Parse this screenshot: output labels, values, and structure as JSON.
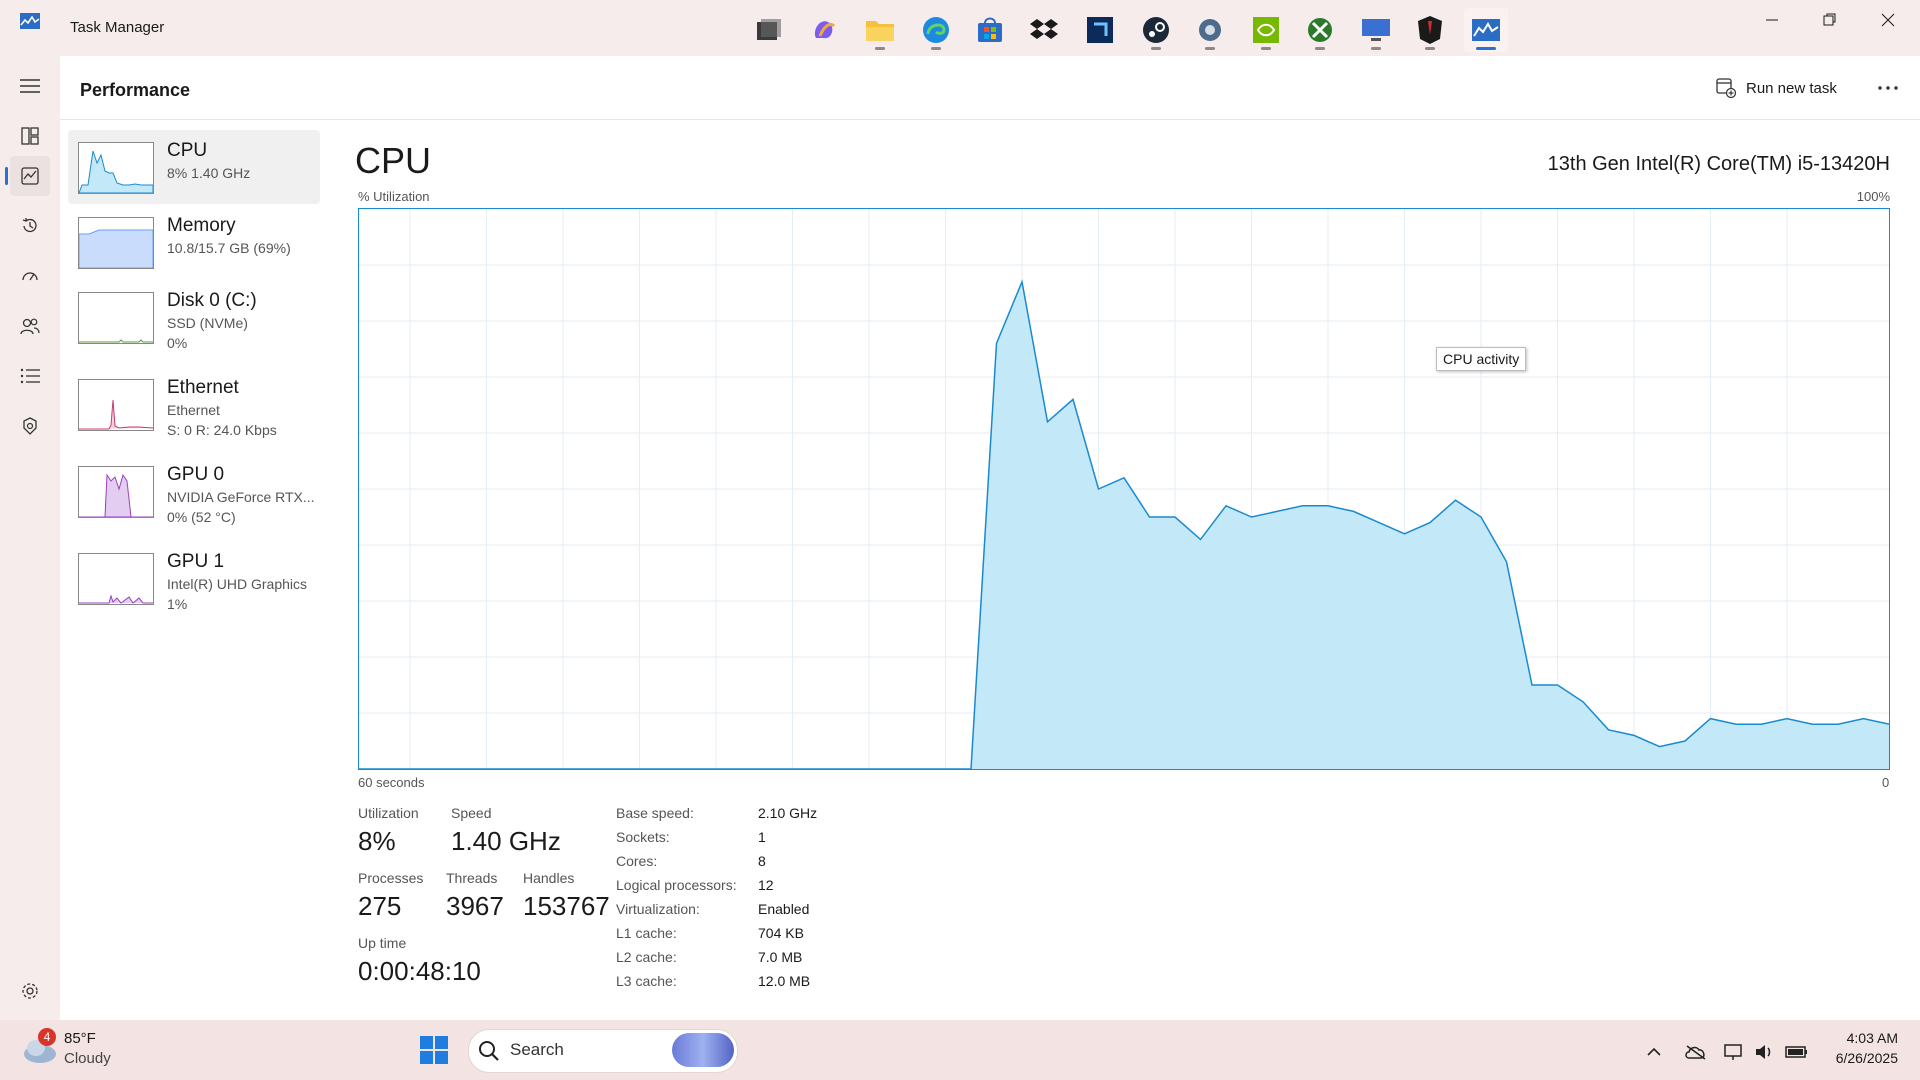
{
  "window": {
    "title": "Task Manager",
    "page_title": "Performance",
    "run_new_task": "Run new task"
  },
  "sidebar": [
    {
      "name": "CPU",
      "line2": "8%  1.40 GHz",
      "line3": ""
    },
    {
      "name": "Memory",
      "line2": "10.8/15.7 GB (69%)",
      "line3": ""
    },
    {
      "name": "Disk 0 (C:)",
      "line2": "SSD (NVMe)",
      "line3": "0%"
    },
    {
      "name": "Ethernet",
      "line2": "Ethernet",
      "line3": "S: 0 R: 24.0 Kbps"
    },
    {
      "name": "GPU 0",
      "line2": "NVIDIA GeForce RTX...",
      "line3": "0% (52 °C)"
    },
    {
      "name": "GPU 1",
      "line2": "Intel(R) UHD Graphics",
      "line3": "1%"
    }
  ],
  "cpu": {
    "title": "CPU",
    "model": "13th Gen Intel(R) Core(TM) i5-13420H",
    "utilization_label": "% Utilization",
    "max_label": "100%",
    "time_label": "60 seconds",
    "zero_label": "0",
    "tooltip": "CPU activity"
  },
  "chart_data": {
    "type": "area",
    "title": "",
    "xlabel": "60 seconds",
    "ylabel": "% Utilization",
    "x_range": [
      60,
      0
    ],
    "ylim": [
      0,
      100
    ],
    "grid": true,
    "x": [
      60,
      59,
      58,
      57,
      56,
      55,
      54,
      53,
      52,
      51,
      50,
      49,
      48,
      47,
      46,
      45,
      44,
      43,
      42,
      41,
      40,
      39,
      38,
      37,
      36,
      35,
      34,
      33,
      32,
      31,
      30,
      29,
      28,
      27,
      26,
      25,
      24,
      23,
      22,
      21,
      20,
      19,
      18,
      17,
      16,
      15,
      14,
      13,
      12,
      11,
      10,
      9,
      8,
      7,
      6,
      5,
      4,
      3,
      2,
      1,
      0
    ],
    "values": [
      0,
      0,
      0,
      0,
      0,
      0,
      0,
      0,
      0,
      0,
      0,
      0,
      0,
      0,
      0,
      0,
      0,
      0,
      0,
      0,
      0,
      0,
      0,
      0,
      0,
      76,
      87,
      62,
      66,
      50,
      52,
      45,
      45,
      41,
      47,
      45,
      46,
      47,
      47,
      46,
      44,
      42,
      44,
      48,
      45,
      37,
      15,
      15,
      12,
      7,
      6,
      4,
      5,
      9,
      8,
      8,
      9,
      8,
      8,
      9,
      8
    ],
    "series_color": "#1a8ad0",
    "fill_color": "#c3e8f7"
  },
  "stats": {
    "utilization_label": "Utilization",
    "utilization": "8%",
    "speed_label": "Speed",
    "speed": "1.40 GHz",
    "processes_label": "Processes",
    "processes": "275",
    "threads_label": "Threads",
    "threads": "3967",
    "handles_label": "Handles",
    "handles": "153767",
    "uptime_label": "Up time",
    "uptime": "0:00:48:10"
  },
  "info": [
    {
      "key": "Base speed:",
      "value": "2.10 GHz"
    },
    {
      "key": "Sockets:",
      "value": "1"
    },
    {
      "key": "Cores:",
      "value": "8"
    },
    {
      "key": "Logical processors:",
      "value": "12"
    },
    {
      "key": "Virtualization:",
      "value": "Enabled"
    },
    {
      "key": "L1 cache:",
      "value": "704 KB"
    },
    {
      "key": "L2 cache:",
      "value": "7.0 MB"
    },
    {
      "key": "L3 cache:",
      "value": "12.0 MB"
    }
  ],
  "taskbar": {
    "weather_temp": "85°F",
    "weather_desc": "Cloudy",
    "weather_badge": "4",
    "search": "Search",
    "time": "4:03 AM",
    "date": "6/26/2025"
  },
  "colors": {
    "accent": "#2a6fd6",
    "cpu_line": "#1a8ad0",
    "cpu_fill": "#c3e8f7",
    "memory": "#6a9ff5",
    "disk": "#5f9b3a",
    "ethernet": "#c83a72",
    "gpu": "#9a3fbf"
  }
}
